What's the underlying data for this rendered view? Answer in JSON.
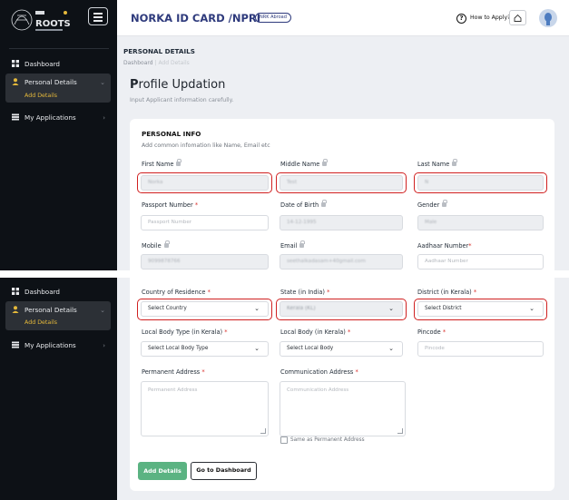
{
  "brand": {
    "logo_text": "NORKA ROOTS"
  },
  "header": {
    "title": "NORKA ID CARD /NPRI",
    "badge": "NRK Abroad",
    "how_to_apply": "How to Apply?"
  },
  "sidebar": {
    "items": [
      {
        "label": "Dashboard",
        "icon": "grid-icon"
      },
      {
        "label": "Personal Details",
        "icon": "user-icon",
        "active": true,
        "sub": "Add Details"
      },
      {
        "label": "My Applications",
        "icon": "list-icon"
      }
    ]
  },
  "breadcrumb": {
    "section": "PERSONAL DETAILS",
    "home": "Dashboard",
    "separator": "|",
    "current": "Add Details"
  },
  "page": {
    "title_first": "P",
    "title_rest": "rofile Updation",
    "subtitle": "Input Applicant information carefully."
  },
  "personal_info": {
    "heading": "PERSONAL INFO",
    "description": "Add common infomation like Name, Email etc",
    "first_name": {
      "label": "First Name",
      "value": "Norka"
    },
    "middle_name": {
      "label": "Middle Name",
      "value": "Test"
    },
    "last_name": {
      "label": "Last Name",
      "value": "N"
    },
    "passport": {
      "label": "Passport Number",
      "required": "*",
      "placeholder": "Passport Number"
    },
    "dob": {
      "label": "Date of Birth",
      "value": "14-12-1995"
    },
    "gender": {
      "label": "Gender",
      "value": "Male"
    },
    "mobile": {
      "label": "Mobile",
      "value": "9099878766"
    },
    "email": {
      "label": "Email",
      "value": "seethalkadasam+40gmail.com"
    },
    "aadhaar": {
      "label": "Aadhaar Number",
      "required": "*",
      "placeholder": "Aadhaar Number"
    }
  },
  "address": {
    "country": {
      "label": "Country of Residence",
      "required": "*",
      "value": "Select Country"
    },
    "state": {
      "label": "State (in India)",
      "required": "*",
      "value": "Kerala (KL)"
    },
    "district": {
      "label": "District (in Kerala)",
      "required": "*",
      "value": "Select District"
    },
    "local_body_type": {
      "label": "Local Body Type (in Kerala)",
      "required": "*",
      "value": "Select Local Body Type"
    },
    "local_body": {
      "label": "Local Body (in Kerala)",
      "required": "*",
      "value": "Select Local Body"
    },
    "pincode": {
      "label": "Pincode",
      "required": "*",
      "placeholder": "Pincode"
    },
    "permanent": {
      "label": "Permanent Address",
      "required": "*",
      "placeholder": "Permanent Address"
    },
    "communication": {
      "label": "Communication Address",
      "required": "*",
      "placeholder": "Communication Address"
    },
    "same_as_permanent": "Same as Permanent Address"
  },
  "actions": {
    "add": "Add Details",
    "dashboard": "Go to Dashboard"
  },
  "colors": {
    "brand": "#2e3a7c",
    "accent": "#e5b93b",
    "success": "#5bb382",
    "highlight": "#d02020",
    "sidebar": "#0d1116"
  }
}
